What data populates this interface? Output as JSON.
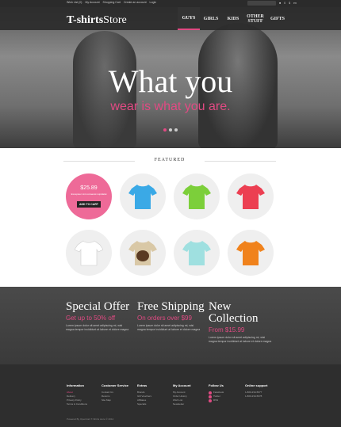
{
  "topbar": {
    "links": [
      "Wish List (0)",
      "My Account",
      "Shopping Cart",
      "Create an account",
      "Login"
    ],
    "cart_count": "0",
    "currency": "$",
    "lang": "en"
  },
  "header": {
    "logo_bold": "T-shirts",
    "logo_light": "Store",
    "nav": [
      "GUYS",
      "GIRLS",
      "KIDS",
      "OTHER STUFF",
      "GIFTS"
    ]
  },
  "hero": {
    "title": "What you",
    "subtitle": "wear is what you are."
  },
  "featured": {
    "title": "FEATURED",
    "promo_price": "$25.89",
    "promo_text": "Excepteur sint occaecat cupidatat",
    "promo_button": "ADD TO CART",
    "products": [
      {
        "color": "#3aa9e6"
      },
      {
        "color": "#7ccf3a"
      },
      {
        "color": "#ec3f52"
      },
      {
        "color": "#ffffff"
      },
      {
        "color": "#d9c8a6"
      },
      {
        "color": "#9fe0e0"
      },
      {
        "color": "#f0821c"
      }
    ]
  },
  "banner": {
    "cols": [
      {
        "title": "Special Offer",
        "highlight": "Get up to 50% off",
        "desc": "Lorem ipsum dolor sit amet adipiscing mi, wisi magna tempor incididunt at labore et dolore magna"
      },
      {
        "title": "Free Shipping",
        "highlight": "On orders over $99",
        "desc": "Lorem ipsum dolor sit amet adipiscing mi, wisi magna tempor incididunt at labore et dolore magna"
      },
      {
        "title": "New Collection",
        "highlight": "From $15.99",
        "desc": "Lorem ipsum dolor sit amet adipiscing mi, wisi magna tempor incididunt at labore et dolore magna"
      }
    ]
  },
  "footer": {
    "columns": [
      {
        "title": "Information",
        "items": [
          "About",
          "Delivery",
          "Privacy Policy",
          "Terms & Conditions"
        ]
      },
      {
        "title": "Customer Service",
        "items": [
          "Contact Us",
          "Returns",
          "Site Map"
        ]
      },
      {
        "title": "Extras",
        "items": [
          "Brands",
          "Gift Vouchers",
          "Affiliates",
          "Specials"
        ]
      },
      {
        "title": "My Account",
        "items": [
          "My Account",
          "Order History",
          "Wish List",
          "Newsletter"
        ]
      },
      {
        "title": "Follow Us",
        "items": [
          "Facebook",
          "Twitter",
          "RSS"
        ]
      },
      {
        "title": "Online support",
        "items": [
          "1-800-234-5677",
          "1-800-234-5678"
        ]
      }
    ],
    "copyright": "Powered By OpenCart T-Shirts store © 2014"
  }
}
